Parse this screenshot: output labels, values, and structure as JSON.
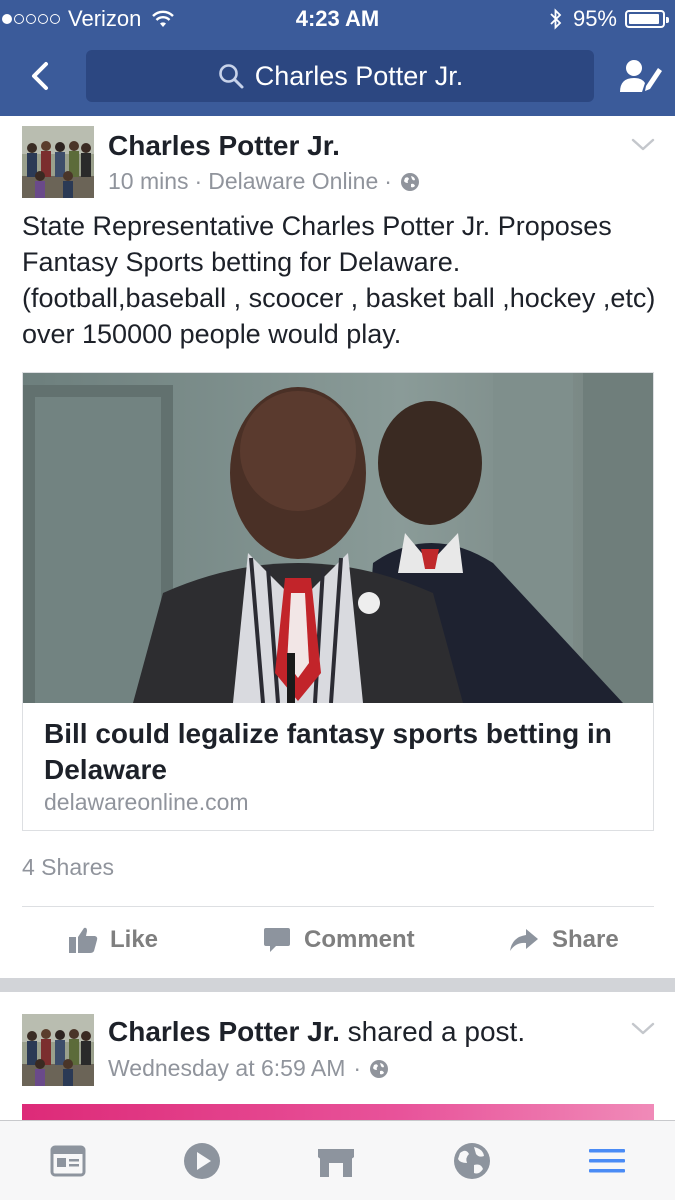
{
  "status_bar": {
    "carrier": "Verizon",
    "time": "4:23 AM",
    "battery": "95%",
    "battery_level": 0.95,
    "signal_bars_filled": 1,
    "signal_bars_total": 5
  },
  "nav": {
    "search_text": "Charles Potter Jr.",
    "back_icon": "chevron-left-icon",
    "profile_icon": "person-edit-icon"
  },
  "post1": {
    "author": "Charles Potter Jr.",
    "time": "10 mins",
    "separator": "·",
    "source": "Delaware Online",
    "text": "State Representative Charles Potter Jr. Proposes Fantasy Sports betting for Delaware. (football,baseball , scoocer , basket ball ,hockey ,etc) over 150000 people would play.",
    "link": {
      "title": "Bill could legalize fantasy sports betting in Delaware",
      "domain": "delawareonline.com"
    },
    "shares": "4 Shares",
    "actions": {
      "like": "Like",
      "comment": "Comment",
      "share": "Share"
    }
  },
  "post2": {
    "author": "Charles Potter Jr.",
    "shared_text": " shared a post.",
    "time": "Wednesday at 6:59 AM",
    "separator": "·"
  },
  "tabbar": {
    "tabs": [
      "news-feed-icon",
      "video-icon",
      "marketplace-icon",
      "globe-icon",
      "menu-icon"
    ],
    "active_color": "#4a8bf5",
    "inactive_color": "#8d949e"
  },
  "colors": {
    "header": "#3b5b9a",
    "search_bg": "#2c4781",
    "text": "#1d2129",
    "meta": "#90949c"
  }
}
